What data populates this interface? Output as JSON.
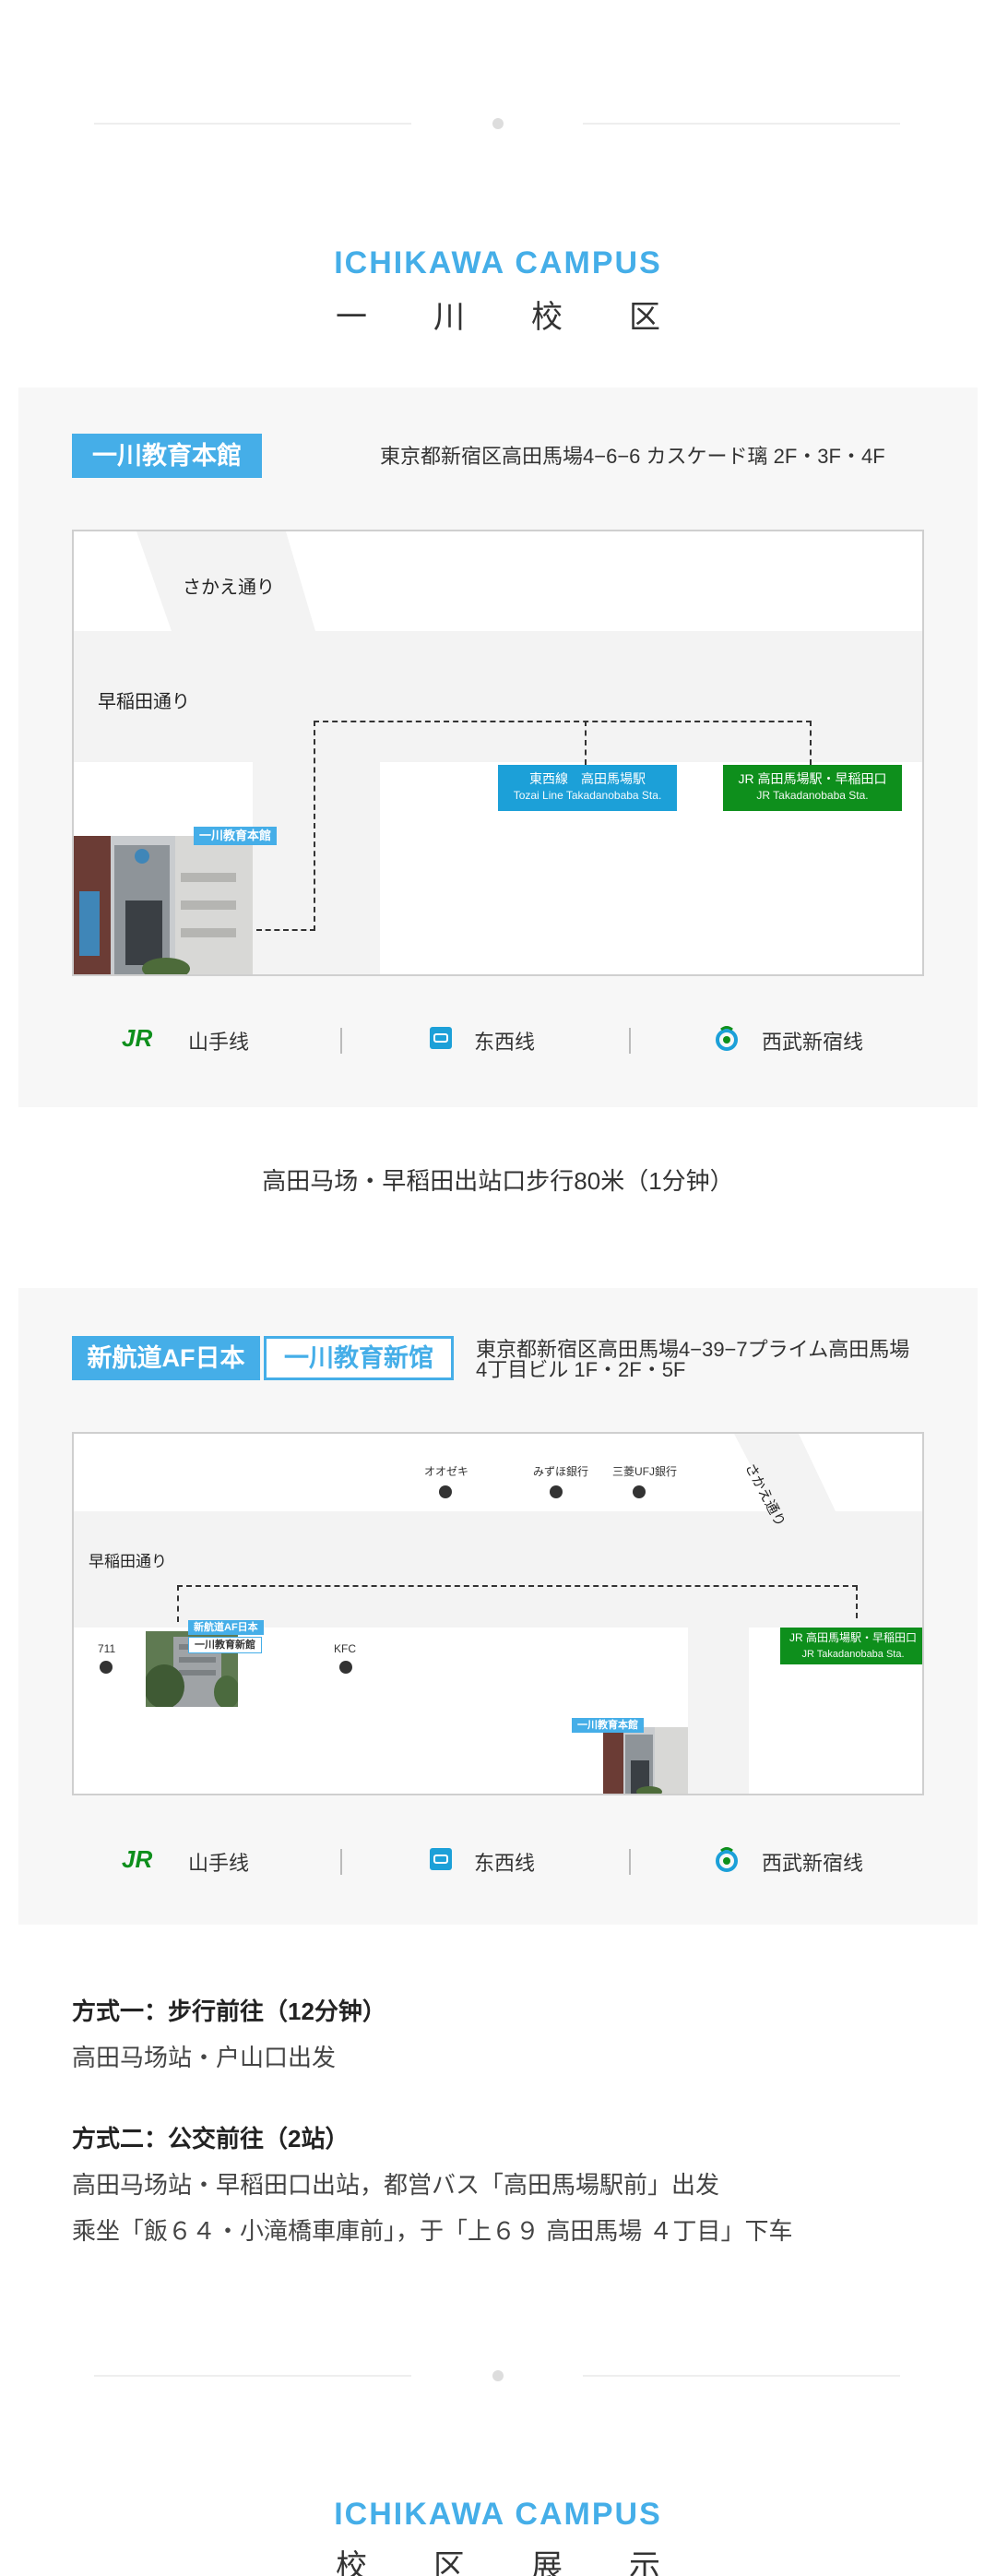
{
  "heading1": {
    "en": "ICHIKAWA CAMPUS",
    "cn": "一川校区"
  },
  "main_building": {
    "tag": "一川教育本館",
    "address": "東京都新宿区高田馬場4−6−6 カスケード璃 2F・3F・4F",
    "map": {
      "street_top": "さかえ通り",
      "street_main": "早稲田通り",
      "photo_tag": "一川教育本館",
      "station_tozai": {
        "name": "東西線　高田馬場駅",
        "en": "Tozai Line Takadanobaba Sta.",
        "color": "#1ca0d8"
      },
      "station_jr": {
        "name": "JR 高田馬場駅・早稲田口",
        "en": "JR Takadanobaba Sta.",
        "color": "#0e8f1c"
      }
    },
    "lines": [
      {
        "icon": "jr-logo-icon",
        "label": "山手线"
      },
      {
        "icon": "tozai-logo-icon",
        "label": "东西线"
      },
      {
        "icon": "seibu-logo-icon",
        "label": "西武新宿线"
      }
    ],
    "walk_note": "高田马场・早稻田出站口步行80米（1分钟）"
  },
  "new_building": {
    "tag_af": "新航道AF日本",
    "tag_new": "一川教育新馆",
    "address_line1": "東京都新宿区高田馬場4−39−7プライム高田馬場",
    "address_line2": "4丁目ビル 1F・2F・5F",
    "map": {
      "street_main": "早稲田通り",
      "street_diag": "さかえ通り",
      "banks": [
        "オオゼキ",
        "みずほ銀行",
        "三菱UFJ銀行"
      ],
      "shop_711": "711",
      "shop_kfc": "KFC",
      "photo_tag_af": "新航道AF日本",
      "photo_tag_new": "一川教育新館",
      "photo_tag_main": "一川教育本館",
      "station_jr": {
        "name": "JR 高田馬場駅・早稲田口",
        "en": "JR Takadanobaba Sta.",
        "color": "#0e8f1c"
      }
    },
    "lines": [
      {
        "icon": "jr-logo-icon",
        "label": "山手线"
      },
      {
        "icon": "tozai-logo-icon",
        "label": "东西线"
      },
      {
        "icon": "seibu-logo-icon",
        "label": "西武新宿线"
      }
    ]
  },
  "methods": [
    {
      "title": "方式一：步行前往（12分钟）",
      "lines": [
        "高田马场站・户山口出发"
      ]
    },
    {
      "title": "方式二：公交前往（2站）",
      "lines": [
        "高田马场站・早稻田口出站，都営バス「高田馬場駅前」出发",
        "乘坐「飯６４・小滝橋車庫前」，于「上６９ 高田馬場 ４丁目」下车"
      ]
    }
  ],
  "heading2": {
    "en": "ICHIKAWA CAMPUS",
    "cn": "校区展示"
  },
  "colors": {
    "accent": "#45aee8",
    "jr_green": "#0e8f1c",
    "tozai_blue": "#1ca0d8"
  }
}
